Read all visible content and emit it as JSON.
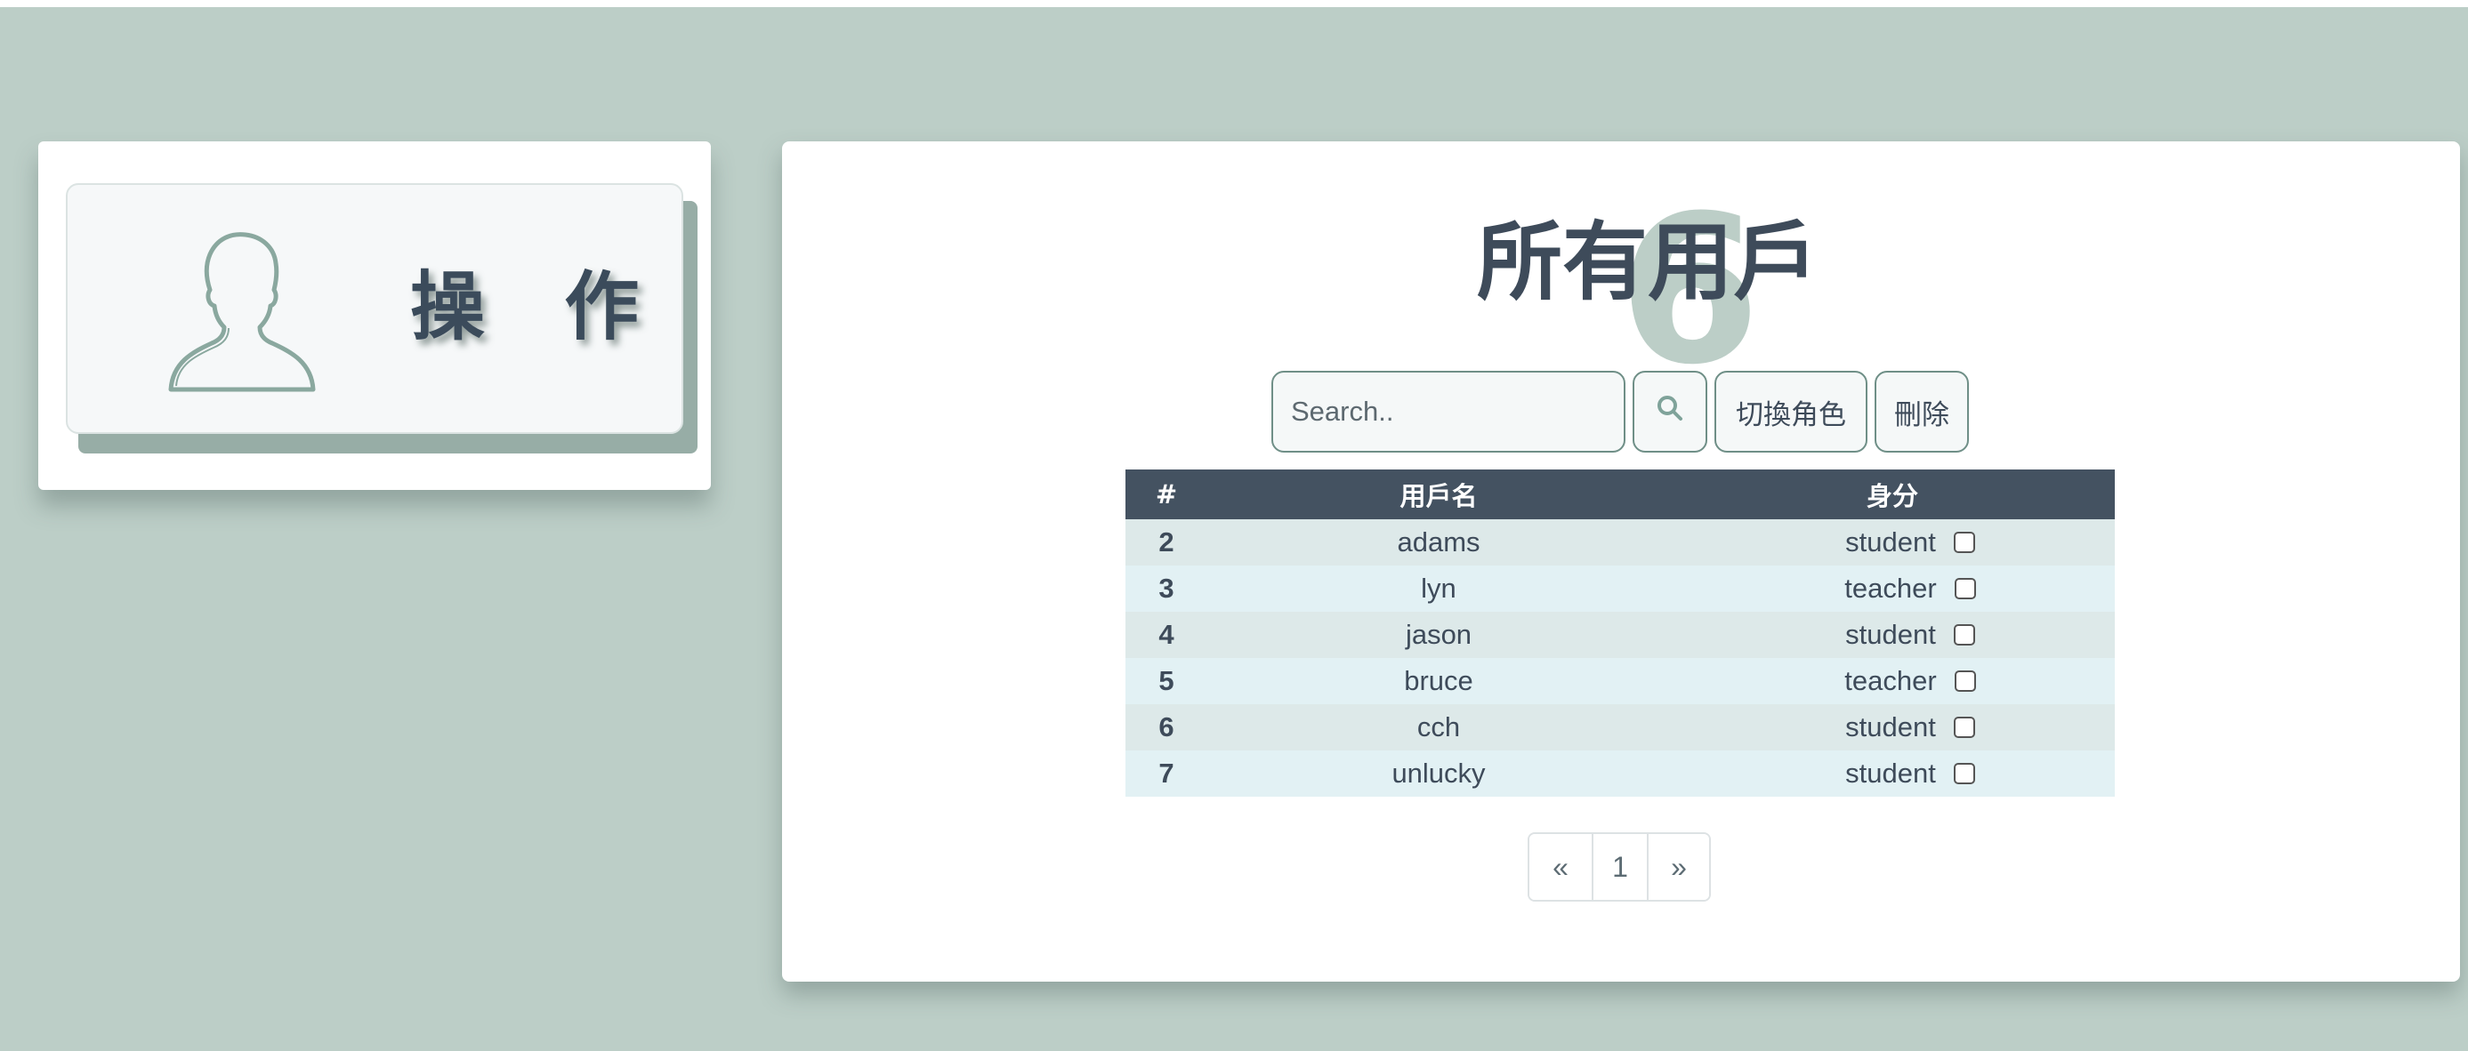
{
  "sidebar": {
    "action_card": {
      "label": "操 作",
      "icon": "user-silhouette-icon"
    }
  },
  "main": {
    "title": "所有用戶",
    "title_background_glyph": "6",
    "search": {
      "placeholder": "Search..",
      "value": ""
    },
    "search_button_icon": "search-icon",
    "switch_role_label": "切換角色",
    "delete_label": "刪除",
    "table": {
      "headers": [
        "#",
        "用戶名",
        "身分"
      ],
      "rows": [
        {
          "id": "2",
          "username": "adams",
          "role": "student",
          "checked": false
        },
        {
          "id": "3",
          "username": "lyn",
          "role": "teacher",
          "checked": false
        },
        {
          "id": "4",
          "username": "jason",
          "role": "student",
          "checked": false
        },
        {
          "id": "5",
          "username": "bruce",
          "role": "teacher",
          "checked": false
        },
        {
          "id": "6",
          "username": "cch",
          "role": "student",
          "checked": false
        },
        {
          "id": "7",
          "username": "unlucky",
          "role": "student",
          "checked": false
        }
      ]
    },
    "pagination": {
      "prev": "«",
      "current": "1",
      "next": "»"
    }
  },
  "colors": {
    "background": "#bccec7",
    "header_dark": "#445261",
    "accent": "#6f8f87",
    "text": "#3e4b5a"
  }
}
